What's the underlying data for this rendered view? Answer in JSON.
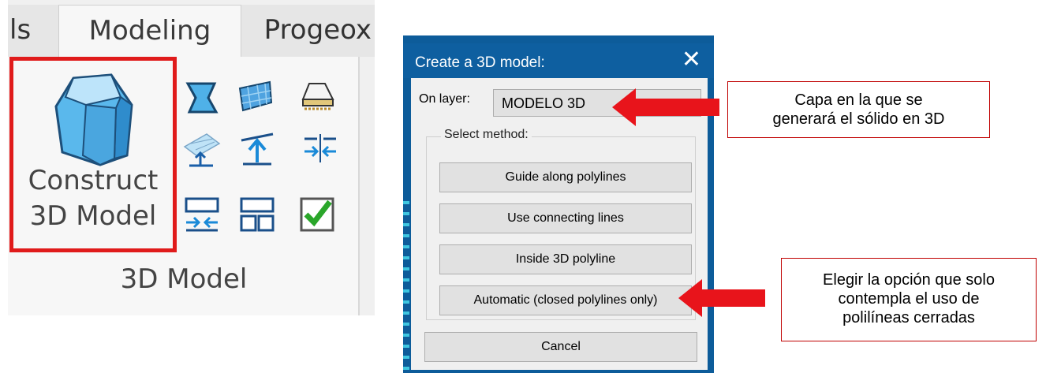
{
  "ribbon": {
    "tabs": [
      {
        "label": "ls"
      },
      {
        "label": "Modeling"
      },
      {
        "label": "Progeox"
      }
    ],
    "construct_button": {
      "line1": "Construct",
      "line2": "3D Model"
    },
    "panel_title": "3D Model",
    "small_tools": [
      "surface-s-icon",
      "mesh-flag-icon",
      "solid-slab-icon",
      "project-mesh-icon",
      "extend-up-icon",
      "join-arrows-icon",
      "split-down-icon",
      "merge-blocks-icon",
      "check-solid-icon"
    ]
  },
  "dialog": {
    "title": "Create a 3D model:",
    "on_layer_label": "On layer:",
    "layer_value": "MODELO 3D",
    "group_label": "Select method:",
    "buttons": [
      {
        "label": "Guide along polylines"
      },
      {
        "label": "Use connecting lines"
      },
      {
        "label": "Inside 3D polyline"
      },
      {
        "label": "Automatic (closed polylines only)"
      }
    ],
    "cancel_label": "Cancel"
  },
  "callouts": {
    "layer": {
      "line1": "Capa en la que se",
      "line2": "generará el sólido en 3D"
    },
    "option": {
      "line1": "Elegir la opción que solo",
      "line2": "contempla el uso de",
      "line3": "polilíneas cerradas"
    }
  },
  "colors": {
    "highlight_red": "#e01b1b",
    "arrow_red": "#e8141b",
    "dialog_blue": "#0e5fa0",
    "icon_blue": "#4fb1e8"
  }
}
